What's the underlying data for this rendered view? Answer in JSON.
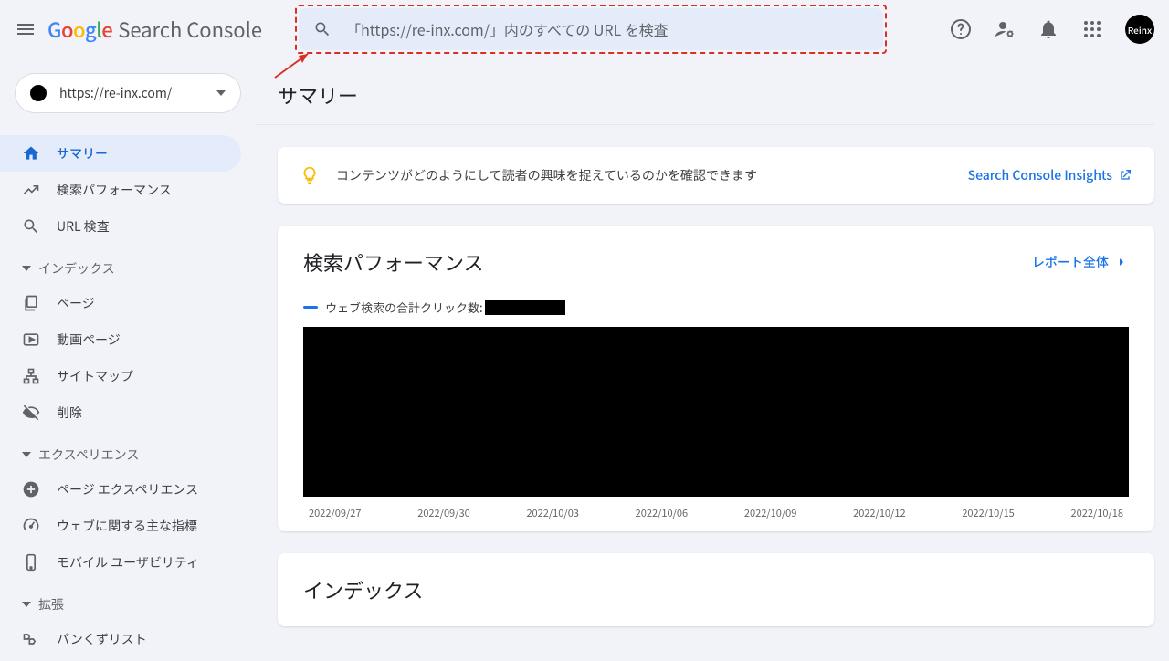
{
  "header": {
    "logo_product": "Search Console",
    "search_placeholder": "「https://re-inx.com/」内のすべての URL を検査",
    "avatar_label": "Reinx"
  },
  "sidebar": {
    "property_url": "https://re-inx.com/",
    "items_top": [
      {
        "label": "サマリー",
        "icon": "home",
        "active": true
      },
      {
        "label": "検索パフォーマンス",
        "icon": "trend",
        "active": false
      },
      {
        "label": "URL 検査",
        "icon": "search",
        "active": false
      }
    ],
    "section_index": "インデックス",
    "items_index": [
      {
        "label": "ページ",
        "icon": "pages"
      },
      {
        "label": "動画ページ",
        "icon": "video"
      },
      {
        "label": "サイトマップ",
        "icon": "sitemap"
      },
      {
        "label": "削除",
        "icon": "remove"
      }
    ],
    "section_experience": "エクスペリエンス",
    "items_experience": [
      {
        "label": "ページ エクスペリエンス",
        "icon": "plus-circle"
      },
      {
        "label": "ウェブに関する主な指標",
        "icon": "speed"
      },
      {
        "label": "モバイル ユーザビリティ",
        "icon": "phone"
      }
    ],
    "section_ext": "拡張",
    "items_ext": [
      {
        "label": "パンくずリスト",
        "icon": "breadcrumb"
      }
    ]
  },
  "page": {
    "title": "サマリー"
  },
  "insights": {
    "text": "コンテンツがどのようにして読者の興味を捉えているのかを確認できます",
    "link_label": "Search Console Insights"
  },
  "performance": {
    "title": "検索パフォーマンス",
    "full_report_label": "レポート全体",
    "legend_label": "ウェブ検索の合計クリック数:"
  },
  "chart_data": {
    "type": "line",
    "title": "検索パフォーマンス",
    "xlabel": "",
    "ylabel": "",
    "x": [
      "2022/09/27",
      "2022/09/30",
      "2022/10/03",
      "2022/10/06",
      "2022/10/09",
      "2022/10/12",
      "2022/10/15",
      "2022/10/18"
    ],
    "series": [
      {
        "name": "ウェブ検索の合計クリック数",
        "values": null,
        "note": "values redacted in source image"
      }
    ]
  },
  "index_card": {
    "title": "インデックス"
  }
}
